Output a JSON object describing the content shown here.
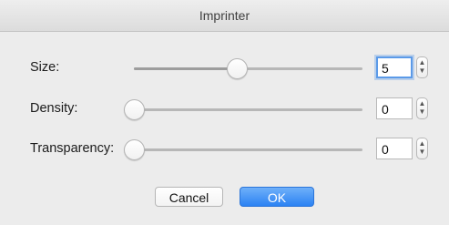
{
  "window": {
    "title": "Imprinter"
  },
  "rows": [
    {
      "label": "Size:",
      "value": "5",
      "slider_fraction": 0.45,
      "focused": true
    },
    {
      "label": "Density:",
      "value": "0",
      "slider_fraction": 0.0,
      "focused": false
    },
    {
      "label": "Transparency:",
      "value": "0",
      "slider_fraction": 0.0,
      "focused": false
    }
  ],
  "buttons": {
    "cancel": "Cancel",
    "ok": "OK"
  },
  "icons": {
    "stepper_up": "chevron-up-icon",
    "stepper_down": "chevron-down-icon"
  },
  "colors": {
    "accent": "#2b82f3",
    "focus_ring": "#5b9ae8",
    "background": "#ececec"
  }
}
